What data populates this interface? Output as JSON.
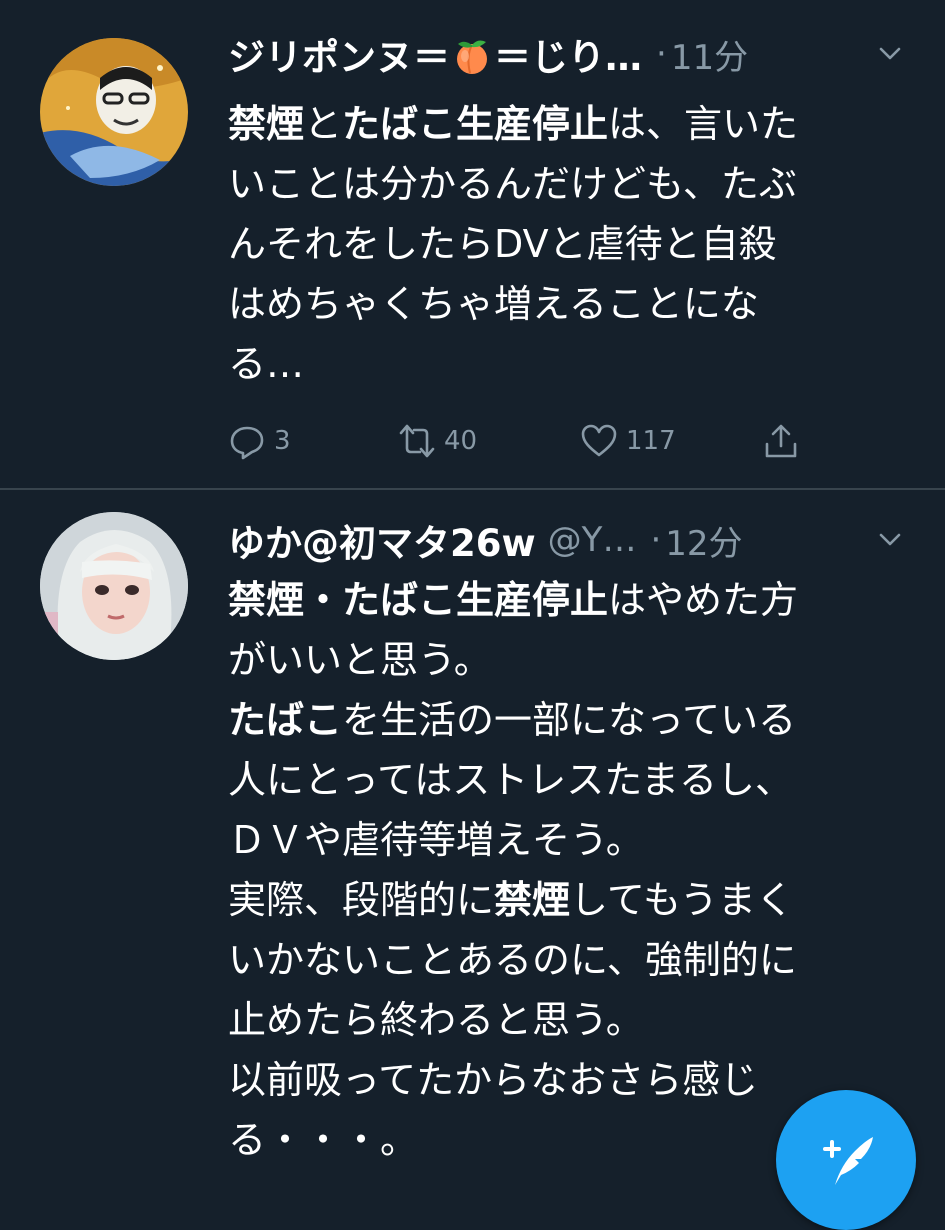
{
  "tweets": [
    {
      "name_part1": "ジリポンヌ＝",
      "name_emoji": "peach-emoji",
      "name_part2": "＝じり…",
      "handle": "",
      "time": "11分",
      "lines": [
        [
          {
            "t": "禁煙",
            "b": true
          },
          {
            "t": "と"
          },
          {
            "t": "たばこ生産停止",
            "b": true
          },
          {
            "t": "は、言いた"
          }
        ],
        [
          {
            "t": "いことは分かるんだけども、たぶ"
          }
        ],
        [
          {
            "t": "んそれをしたらDVと虐待と自殺"
          }
        ],
        [
          {
            "t": "はめちゃくちゃ増えることにな"
          }
        ],
        [
          {
            "t": "る…"
          }
        ]
      ],
      "replies": "3",
      "retweets": "40",
      "likes": "117"
    },
    {
      "name": "ゆか@初マタ26w",
      "handle": "@Y…",
      "time": "12分",
      "lines": [
        [
          {
            "t": "禁煙・たばこ生産停止",
            "b": true
          },
          {
            "t": "はやめた方"
          }
        ],
        [
          {
            "t": "がいいと思う。"
          }
        ],
        [
          {
            "t": "たばこ",
            "b": true
          },
          {
            "t": "を生活の一部になっている"
          }
        ],
        [
          {
            "t": "人にとってはストレスたまるし、"
          }
        ],
        [
          {
            "t": "ＤＶや虐待等増えそう。"
          }
        ],
        [
          {
            "t": "実際、段階的に"
          },
          {
            "t": "禁煙",
            "b": true
          },
          {
            "t": "してもうまく"
          }
        ],
        [
          {
            "t": "いかないことあるのに、強制的に"
          }
        ],
        [
          {
            "t": "止めたら終わると思う。"
          }
        ],
        [
          {
            "t": "以前吸ってたからなおさら感じ"
          }
        ],
        [
          {
            "t": "る・・・。"
          }
        ]
      ]
    }
  ],
  "dot": "·",
  "colors": {
    "background": "#15202b",
    "text": "#ffffff",
    "muted": "#8899a6",
    "divider": "#38444d",
    "accent": "#1da1f2"
  },
  "icons": {
    "reply": "reply-icon",
    "retweet": "retweet-icon",
    "like": "heart-icon",
    "share": "share-icon",
    "chevron": "chevron-down-icon",
    "compose": "compose-tweet-icon"
  }
}
